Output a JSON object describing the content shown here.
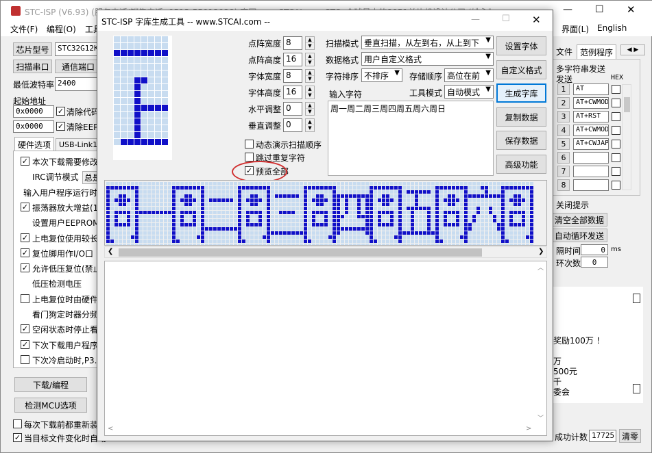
{
  "bg": {
    "title": "STC-ISP (V6.93) (服务电话/销售电话: 0513-55012928) 官网www.STCAI.com   STC: 全球最大的8051单片机设计公司 (姚永平)",
    "menu": [
      "文件(F)",
      "编程(O)",
      "工具"
    ],
    "menu_right": [
      "界面(L)",
      "English"
    ],
    "chip_label": "芯片型号",
    "chip_value": "STC32G12K1",
    "scan_port": "扫描串口",
    "comm_port": "通信端口",
    "baud_label": "最低波特率",
    "baud_value": "2400",
    "start_addr": "起始地址",
    "addr1": "0x0000",
    "clear_code": "清除代码",
    "addr2": "0x0000",
    "clear_eeprom": "清除EEPR",
    "tab_hw": "硬件选项",
    "tab_usb": "USB-Link1I",
    "options": [
      {
        "c": true,
        "t": "本次下载需要修改"
      },
      {
        "c": null,
        "t": "IRC调节模式",
        "extra": "总是"
      },
      {
        "c": null,
        "t": "输入用户程序运行时"
      },
      {
        "c": true,
        "t": "振荡器放大增益(1"
      },
      {
        "c": null,
        "t": "设置用户EEPROM大"
      },
      {
        "c": true,
        "t": "上电复位使用较长"
      },
      {
        "c": true,
        "t": "复位脚用作I/O口"
      },
      {
        "c": true,
        "t": "允许低压复位(禁止"
      },
      {
        "c": null,
        "t": "低压检测电压"
      },
      {
        "c": false,
        "t": "上电复位时由硬件"
      },
      {
        "c": null,
        "t": "看门狗定时器分频"
      },
      {
        "c": true,
        "t": "空闲状态时停止看"
      },
      {
        "c": true,
        "t": "下次下载用户程序"
      },
      {
        "c": false,
        "t": "下次冷启动时,P3."
      }
    ],
    "download": "下载/编程",
    "detect": "检测MCU选项",
    "bottom1": "每次下载前都重新装载",
    "bottom2": "当目标文件变化时自动",
    "right_tabs": [
      "文件",
      "范例程序"
    ],
    "serial_title": "多字符串发送",
    "send_col": "发送",
    "hex_col": "HEX",
    "serial_rows": [
      {
        "n": "1",
        "v": "AT"
      },
      {
        "n": "2",
        "v": "AT+CWMODE"
      },
      {
        "n": "3",
        "v": "AT+RST"
      },
      {
        "n": "4",
        "v": "AT+CWMODE"
      },
      {
        "n": "5",
        "v": "AT+CWJAP"
      },
      {
        "n": "6",
        "v": ""
      },
      {
        "n": "7",
        "v": ""
      },
      {
        "n": "8",
        "v": ""
      }
    ],
    "close_hint": "关闭提示",
    "clear_all": "清空全部数据",
    "auto_loop": "自动循环发送",
    "interval_label": "隔时间",
    "interval_value": "0",
    "interval_unit": "ms",
    "loop_label": "环次数",
    "loop_value": "0",
    "promo": [
      "奖励100万 ！",
      "万",
      "500元",
      "千",
      "委会"
    ],
    "success_label": "成功计数",
    "success_value": "17725",
    "clear_btn": "清零"
  },
  "dialog": {
    "title": "STC-ISP 字库生成工具 -- www.STCAI.com --",
    "minimize": "—",
    "maximize": "☐",
    "close": "✕",
    "fields": [
      {
        "label": "点阵宽度",
        "value": "8"
      },
      {
        "label": "点阵高度",
        "value": "16"
      },
      {
        "label": "字体宽度",
        "value": "8"
      },
      {
        "label": "字体高度",
        "value": "16"
      },
      {
        "label": "水平调整",
        "value": "0"
      },
      {
        "label": "垂直调整",
        "value": "0"
      }
    ],
    "scan_mode_label": "扫描模式",
    "scan_mode_value": "垂直扫描，从左到右，从上到下",
    "data_format_label": "数据格式",
    "data_format_value": "用户自定义格式",
    "char_sort_label": "字符排序",
    "char_sort_value": "不排序",
    "storage_label": "存储顺序",
    "storage_value": "高位在前",
    "input_label": "输入字符",
    "tool_mode_label": "工具模式",
    "tool_mode_value": "自动模式",
    "input_text": "周一周二周三周四周五周六周日",
    "chk_animate": "动态演示扫描顺序",
    "chk_skip": "跳过重复字符",
    "chk_preview": "预览全部",
    "buttons": [
      "设置字体",
      "自定义格式",
      "生成字库",
      "复制数据",
      "保存数据",
      "高级功能"
    ],
    "preview_chars": [
      "周",
      "一",
      "周",
      "二",
      "周",
      "三",
      "周",
      "四",
      "周",
      "五",
      "周",
      "六",
      "周"
    ]
  },
  "colors": {
    "pixel_on": "#1010c8",
    "pixel_off": "#c8dcf0",
    "accent": "#0078d7",
    "highlight_circle": "#d03030"
  }
}
